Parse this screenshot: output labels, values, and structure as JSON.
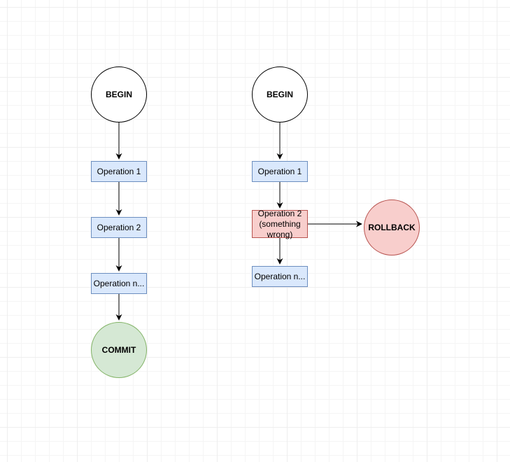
{
  "diagram": {
    "left": {
      "begin": "BEGIN",
      "op1": "Operation 1",
      "op2": "Operation 2",
      "op3": "Operation n...",
      "commit": "COMMIT"
    },
    "right": {
      "begin": "BEGIN",
      "op1": "Operation 1",
      "op2": "Operation 2\n(something wrong)",
      "op3": "Operation n...",
      "rollback": "ROLLBACK"
    }
  }
}
